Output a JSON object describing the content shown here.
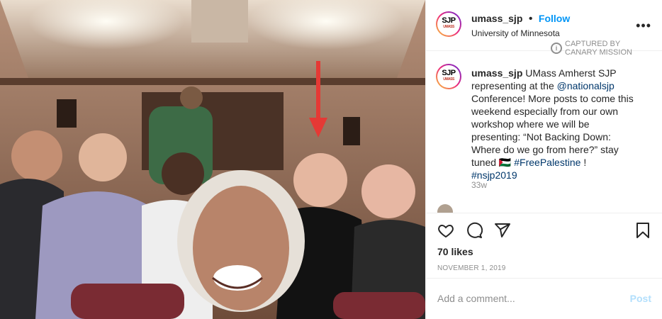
{
  "post": {
    "username": "umass_sjp",
    "follow_label": "Follow",
    "location": "University of Minnesota",
    "avatar_text": "SJP",
    "avatar_subtext": "UMASS",
    "more_icon": "more-horizontal-icon",
    "watermark_line1": "CAPTURED BY",
    "watermark_line2": "CANARY MISSION"
  },
  "caption": {
    "username": "umass_sjp",
    "text_before": "UMass Amherst SJP representing at the",
    "mention": "@nationalsjp",
    "text_after": "Conference! More posts to come this weekend especially from our own workshop where we will be presenting: “Not Backing Down: Where do we go from here?” stay tuned 🇵🇸",
    "hashtag1": "#FreePalestine",
    "separator": "!",
    "hashtag2": "#nsjp2019",
    "time_ago": "33w"
  },
  "actions": {
    "like_icon": "heart-icon",
    "comment_icon": "comment-icon",
    "share_icon": "share-icon",
    "save_icon": "bookmark-icon",
    "likes": "70 likes",
    "date": "NOVEMBER 1, 2019"
  },
  "comment_box": {
    "placeholder": "Add a comment...",
    "post_label": "Post"
  },
  "colors": {
    "link": "#00376b",
    "follow": "#0095f6",
    "muted": "#8e8e8e",
    "annotation_arrow": "#e53935"
  }
}
